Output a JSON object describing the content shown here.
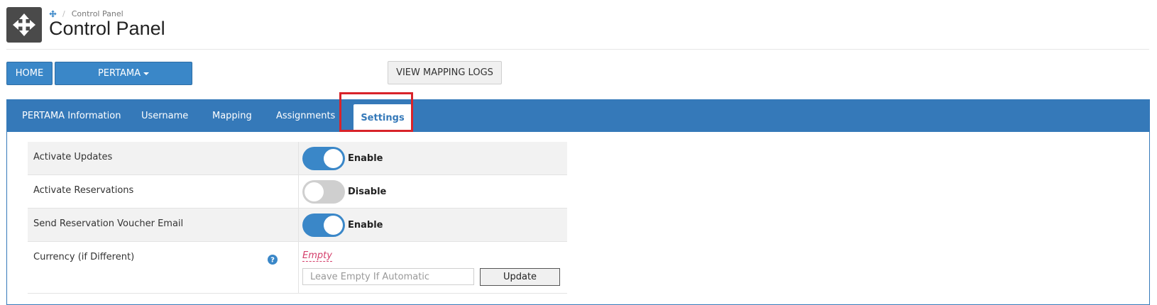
{
  "header": {
    "app_icon": "move-arrows-icon",
    "breadcrumb": {
      "home_icon": "move-arrows-icon",
      "separator": "/",
      "current": "Control Panel"
    },
    "title": "Control Panel"
  },
  "toolbar": {
    "home_label": "HOME",
    "pertama_label": "PERTAMA",
    "view_logs_label": "VIEW MAPPING LOGS"
  },
  "tabs": [
    {
      "label": "PERTAMA Information",
      "active": false
    },
    {
      "label": "Username",
      "active": false
    },
    {
      "label": "Mapping",
      "active": false
    },
    {
      "label": "Assignments",
      "active": false
    },
    {
      "label": "Settings",
      "active": true
    }
  ],
  "settings": {
    "rows": [
      {
        "label": "Activate Updates",
        "state": "Enable",
        "on": true
      },
      {
        "label": "Activate Reservations",
        "state": "Disable",
        "on": false
      },
      {
        "label": "Send Reservation Voucher Email",
        "state": "Enable",
        "on": true
      }
    ],
    "currency": {
      "label": "Currency (if Different)",
      "help_icon": "question-circle-icon",
      "value": "Empty",
      "placeholder": "Leave Empty If Automatic",
      "update_label": "Update"
    }
  },
  "colors": {
    "primary": "#3579b9",
    "button_blue": "#3a87c8",
    "highlight": "#d8232a",
    "empty_text": "#d43f6b"
  }
}
